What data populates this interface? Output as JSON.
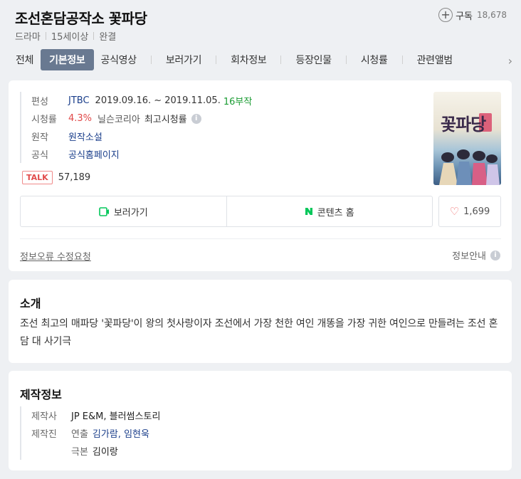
{
  "header": {
    "title": "조선혼담공작소 꽃파당",
    "meta": [
      "드라마",
      "15세이상",
      "완결"
    ],
    "subscribe_label": "구독",
    "subscribe_count": "18,678"
  },
  "tabs": [
    "전체",
    "기본정보",
    "공식영상",
    "보러가기",
    "회차정보",
    "등장인물",
    "시청률",
    "관련앨범"
  ],
  "info": {
    "broadcast_label": "편성",
    "broadcaster": "JTBC",
    "period": "2019.09.16. ~ 2019.11.05.",
    "episodes": "16부작",
    "rating_label": "시청률",
    "rating_value": "4.3%",
    "rating_source": "닐슨코리아",
    "rating_note": "최고시청률",
    "original_label": "원작",
    "original_value": "원작소설",
    "official_label": "공식",
    "official_value": "공식홈페이지",
    "talk_badge": "TALK",
    "talk_count": "57,189",
    "poster_title": "꽃파당"
  },
  "actions": {
    "watch_label": "보러가기",
    "content_home_label": "콘텐츠 홈",
    "like_count": "1,699"
  },
  "footer_links": {
    "report": "정보오류 수정요청",
    "guide": "정보안내"
  },
  "intro": {
    "title": "소개",
    "body": "조선 최고의 매파당 '꽃파당'이 왕의 첫사랑이자 조선에서 가장 천한 여인 개똥을 가장 귀한 여인으로 만들려는 조선 혼담 대 사기극"
  },
  "production": {
    "title": "제작정보",
    "company_label": "제작사",
    "company_value": "JP E&M, 블러썸스토리",
    "staff_label": "제작진",
    "director_label": "연출",
    "directors": "김가람, 임현욱",
    "writer_label": "극본",
    "writer": "김이랑"
  },
  "colors": {
    "active_tab": "#697991",
    "link_blue": "#1b3f8b",
    "episodes_green": "#1b9c33",
    "rating_red": "#e04848",
    "naver_green": "#03c75a"
  }
}
